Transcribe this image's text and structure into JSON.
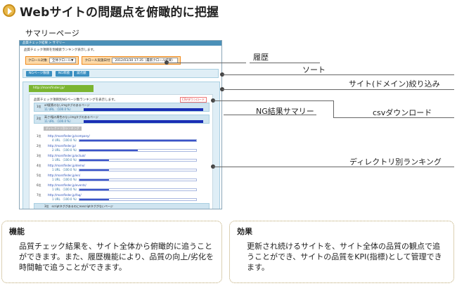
{
  "title": "Webサイトの問題点を俯瞰的に把握",
  "summary_label": "サマリーページ",
  "screen": {
    "header": "品質チェック結果 > サマリー",
    "subtitle": "品質チェック項目を別検索ランキング表示します。",
    "history": {
      "scope_label": "クロール対象",
      "scope_value": "全体クロール▼",
      "date_label": "クロール実施日付",
      "date_value": "2012/03/30 17:35（最新クロール結果）"
    },
    "sort_buttons": [
      "NGページ数順",
      "NG率順",
      "減点順"
    ],
    "domain": "http://marsfinder.jp/",
    "inner_note": "品質チェック項目別NGページ数ランキングを表示します。",
    "csv_button": "CSVダウンロード",
    "ng_rows": [
      {
        "rank": "1位",
        "label": "alt要素のないimgタグのあるページ",
        "count": "11 URL （100.0 %）"
      },
      {
        "rank": "2位",
        "label": "高さ/幅の属性のないimgタグのあるページ",
        "count": "11 URL （100.0 %）"
      }
    ],
    "dir_tab": "ディレクトリ別ランキング",
    "dir_rows": [
      {
        "rank": "1位",
        "url": "http://marsfinder.jp/company/",
        "count": "4 URL （100.0 %）",
        "fill": 1.0
      },
      {
        "rank": "2位",
        "url": "http://marsfinder.jp/",
        "count": "2 URL （100.0 %）",
        "fill": 0.5
      },
      {
        "rank": "3位",
        "url": "http://marsfinder.jp/actual/",
        "count": "1 URL （100.0 %）",
        "fill": 0.25
      },
      {
        "rank": "4位",
        "url": "http://marsfinder.jp/demo/",
        "count": "1 URL （100.0 %）",
        "fill": 0.25
      },
      {
        "rank": "5位",
        "url": "http://marsfinder.jp/en/",
        "count": "1 URL （100.0 %）",
        "fill": 0.25
      },
      {
        "rank": "6位",
        "url": "http://marsfinder.jp/events/",
        "count": "1 URL （100.0 %）",
        "fill": 0.25
      },
      {
        "rank": "7位",
        "url": "http://marsfinder.jp/faq/",
        "count": "1 URL （100.0 %）",
        "fill": 0.25
      }
    ],
    "ng_bottom": "3位　scriptタグがあるのにnoscriptタグがないページ"
  },
  "callouts": {
    "history": "履歴",
    "sort": "ソート",
    "domain_filter": "サイト(ドメイン)絞り込み",
    "ng_summary": "NG結果サマリー",
    "csv": "csvダウンロード",
    "dir_ranking": "ディレクトリ別ランキング"
  },
  "feature_box": {
    "title": "機能",
    "body": "品質チェック結果を、サイト全体から俯瞰的に追うことができます。また、履歴機能により、品質の向上/劣化を時間軸で追うことができます。"
  },
  "effect_box": {
    "title": "効果",
    "body": "更新され続けるサイトを、サイト全体の品質の観点で追うことができ、サイトの品質をKPI(指標)として管理できます。"
  }
}
